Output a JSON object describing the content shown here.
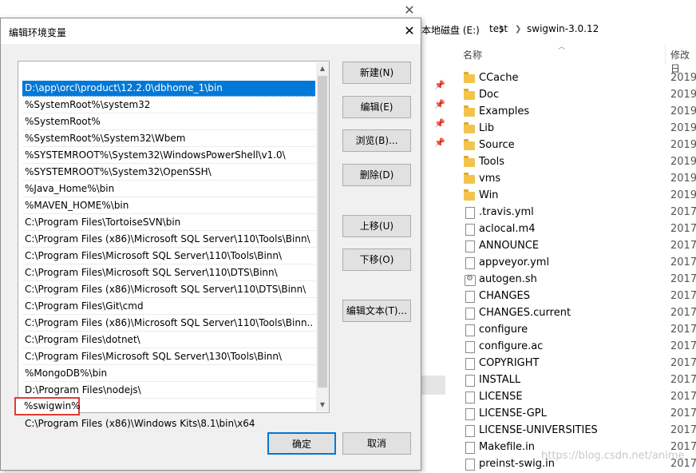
{
  "explorer": {
    "breadcrumb": [
      "本地磁盘 (E:)",
      "test",
      "swigwin-3.0.12"
    ],
    "columns": {
      "name": "名称",
      "modified": "修改日"
    },
    "files": [
      {
        "name": "CCache",
        "date": "2019/",
        "kind": "folder"
      },
      {
        "name": "Doc",
        "date": "2019/",
        "kind": "folder"
      },
      {
        "name": "Examples",
        "date": "2019/",
        "kind": "folder"
      },
      {
        "name": "Lib",
        "date": "2019/",
        "kind": "folder"
      },
      {
        "name": "Source",
        "date": "2019/",
        "kind": "folder"
      },
      {
        "name": "Tools",
        "date": "2019/",
        "kind": "folder"
      },
      {
        "name": "vms",
        "date": "2019/",
        "kind": "folder"
      },
      {
        "name": "Win",
        "date": "2019/",
        "kind": "folder"
      },
      {
        "name": ".travis.yml",
        "date": "2017/",
        "kind": "file"
      },
      {
        "name": "aclocal.m4",
        "date": "2017/",
        "kind": "file"
      },
      {
        "name": "ANNOUNCE",
        "date": "2017/",
        "kind": "file"
      },
      {
        "name": "appveyor.yml",
        "date": "2017/",
        "kind": "file"
      },
      {
        "name": "autogen.sh",
        "date": "2017/",
        "kind": "script"
      },
      {
        "name": "CHANGES",
        "date": "2017/",
        "kind": "file"
      },
      {
        "name": "CHANGES.current",
        "date": "2017/",
        "kind": "file"
      },
      {
        "name": "configure",
        "date": "2017/",
        "kind": "file"
      },
      {
        "name": "configure.ac",
        "date": "2017/",
        "kind": "file"
      },
      {
        "name": "COPYRIGHT",
        "date": "2017/",
        "kind": "file"
      },
      {
        "name": "INSTALL",
        "date": "2017/",
        "kind": "file"
      },
      {
        "name": "LICENSE",
        "date": "2017/",
        "kind": "file"
      },
      {
        "name": "LICENSE-GPL",
        "date": "2017/",
        "kind": "file"
      },
      {
        "name": "LICENSE-UNIVERSITIES",
        "date": "2017/",
        "kind": "file"
      },
      {
        "name": "Makefile.in",
        "date": "2017/",
        "kind": "file"
      },
      {
        "name": "preinst-swig.in",
        "date": "2017/",
        "kind": "file"
      }
    ],
    "watermark": "https://blog.csdn.net/anime"
  },
  "dialog": {
    "title": "编辑环境变量",
    "paths": [
      "D:\\app\\orcl\\product\\12.2.0\\dbhome_1\\bin",
      "%SystemRoot%\\system32",
      "%SystemRoot%",
      "%SystemRoot%\\System32\\Wbem",
      "%SYSTEMROOT%\\System32\\WindowsPowerShell\\v1.0\\",
      "%SYSTEMROOT%\\System32\\OpenSSH\\",
      "%Java_Home%\\bin",
      "%MAVEN_HOME%\\bin",
      "C:\\Program Files\\TortoiseSVN\\bin",
      "C:\\Program Files (x86)\\Microsoft SQL Server\\110\\Tools\\Binn\\",
      "C:\\Program Files\\Microsoft SQL Server\\110\\Tools\\Binn\\",
      "C:\\Program Files\\Microsoft SQL Server\\110\\DTS\\Binn\\",
      "C:\\Program Files (x86)\\Microsoft SQL Server\\110\\DTS\\Binn\\",
      "C:\\Program Files\\Git\\cmd",
      "C:\\Program Files (x86)\\Microsoft SQL Server\\110\\Tools\\Binn...",
      "C:\\Program Files\\dotnet\\",
      "C:\\Program Files\\Microsoft SQL Server\\130\\Tools\\Binn\\",
      "%MongoDB%\\bin",
      "D:\\Program Files\\nodejs\\",
      "%swigwin%",
      "C:\\Program Files (x86)\\Windows Kits\\8.1\\bin\\x64"
    ],
    "selected_index": 0,
    "highlighted_index": 19,
    "buttons": {
      "new": "新建(N)",
      "edit": "编辑(E)",
      "browse": "浏览(B)...",
      "delete": "删除(D)",
      "move_up": "上移(U)",
      "move_down": "下移(O)",
      "edit_text": "编辑文本(T)...",
      "ok": "确定",
      "cancel": "取消"
    }
  }
}
